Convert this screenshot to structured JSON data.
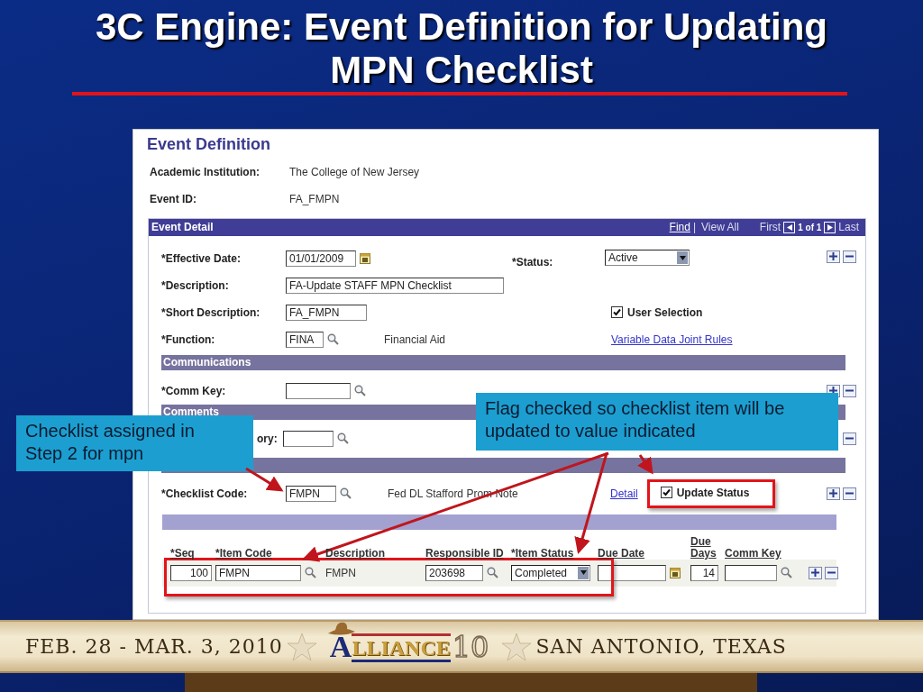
{
  "slide": {
    "title": "3C Engine: Event Definition for Updating MPN Checklist"
  },
  "page": {
    "title": "Event Definition",
    "fields": [
      {
        "label": "Academic Institution:",
        "value": "The College of New Jersey"
      },
      {
        "label": "Event ID:",
        "value": "FA_FMPN"
      }
    ]
  },
  "event_detail": {
    "title": "Event Detail",
    "nav": {
      "find": "Find",
      "separator": "|",
      "view_all": "View All",
      "first": "First",
      "count": "1 of 1",
      "last": "Last"
    },
    "effective_date": {
      "label": "*Effective Date:",
      "value": "01/01/2009"
    },
    "status": {
      "label": "*Status:",
      "value": "Active"
    },
    "description": {
      "label": "*Description:",
      "value": "FA-Update STAFF MPN Checklist"
    },
    "short_description": {
      "label": "*Short Description:",
      "value": "FA_FMPN"
    },
    "function": {
      "label": "*Function:",
      "value": "FINA",
      "description": "Financial Aid"
    },
    "user_selection": {
      "label": "User Selection",
      "checked": true
    },
    "link": "Variable Data Joint Rules"
  },
  "communications": {
    "title": "Communications",
    "comm_key": {
      "label": "*Comm Key:"
    }
  },
  "comments": {
    "title": "Comments",
    "category": {
      "label": "ory:"
    }
  },
  "checklist": {
    "code": {
      "label": "*Checklist Code:",
      "value": "FMPN",
      "description": "Fed DL Stafford Prom Note"
    },
    "detail_link": "Detail",
    "update_status": {
      "label": "Update Status",
      "checked": true
    },
    "columns": [
      "*Seq",
      "*Item Code",
      "Description",
      "Responsible ID",
      "*Item Status",
      "Due Date",
      "Due Days",
      "Comm Key"
    ],
    "rows": [
      {
        "seq": "100",
        "item_code": "FMPN",
        "description": "FMPN",
        "responsible_id": "203698",
        "item_status": "Completed",
        "due_days": "14",
        "highlighted": true
      }
    ]
  },
  "callouts": [
    {
      "text": "Checklist assigned in Step 2 for mpn"
    },
    {
      "text": "Flag checked so checklist item will be updated to value indicated"
    }
  ],
  "footer": {
    "dates": "FEB. 28 - MAR. 3, 2010",
    "logo_text": "ALLIANCE",
    "logo_number": "10",
    "location": "SAN ANTONIO, TEXAS"
  }
}
